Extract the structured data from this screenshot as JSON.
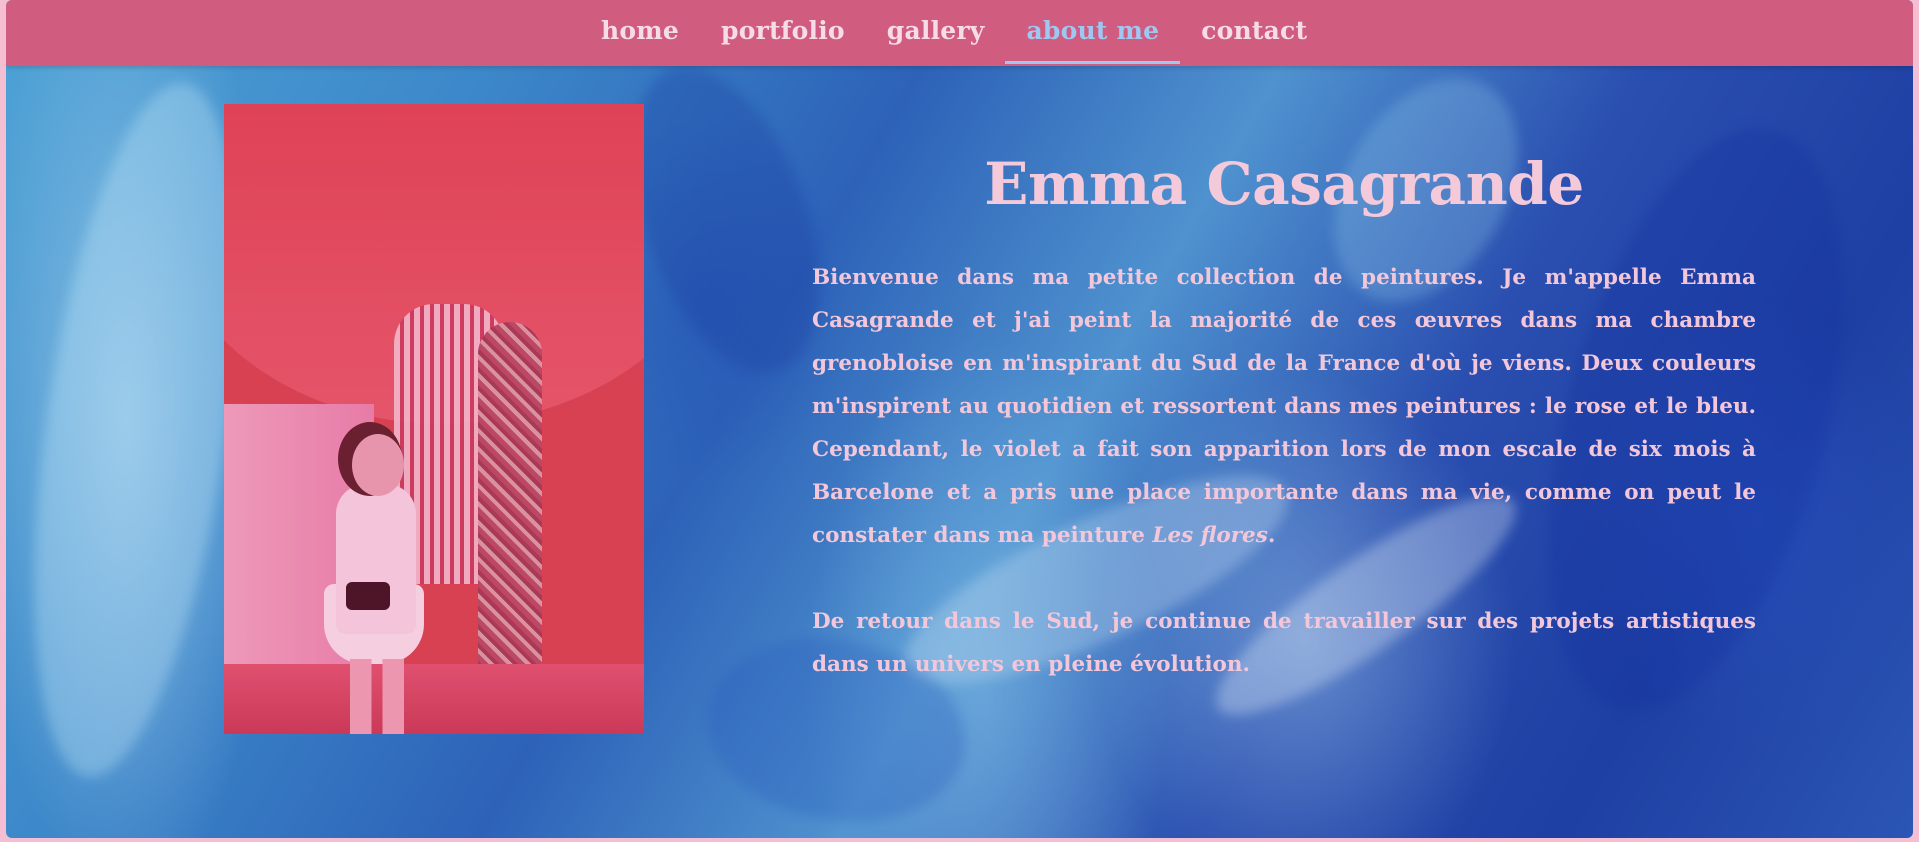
{
  "nav": {
    "items": [
      {
        "label": "home",
        "active": false
      },
      {
        "label": "portfolio",
        "active": false
      },
      {
        "label": "gallery",
        "active": false
      },
      {
        "label": "about me",
        "active": true
      },
      {
        "label": "contact",
        "active": false
      }
    ]
  },
  "about": {
    "name": "Emma Casagrande",
    "paragraph1_text": "Bienvenue dans ma petite collection de peintures. Je m'appelle Emma Casagrande et j'ai peint la majorité de ces œuvres dans ma chambre grenobloise en m'inspirant du Sud de la France d'où je viens. Deux couleurs m'inspirent au quotidien et ressortent dans mes peintures : le rose et le bleu. Cependant, le violet a fait son apparition lors de mon escale de six mois à Barcelone et a pris une place importante dans ma vie, comme on peut le constater dans ma peinture ",
    "paragraph1_italic": "Les flores",
    "paragraph1_end": ".",
    "paragraph2": "De retour dans le Sud, je continue de travailler sur des projets artistiques dans un univers en pleine évolution."
  },
  "colors": {
    "navbar": "#d05c80",
    "nav_text": "#f6dce6",
    "nav_active": "#9ec8f2",
    "body_text": "#f3c7d9",
    "page_border": "#f4bfd3"
  },
  "icons": {
    "portrait": "portrait-photo"
  }
}
